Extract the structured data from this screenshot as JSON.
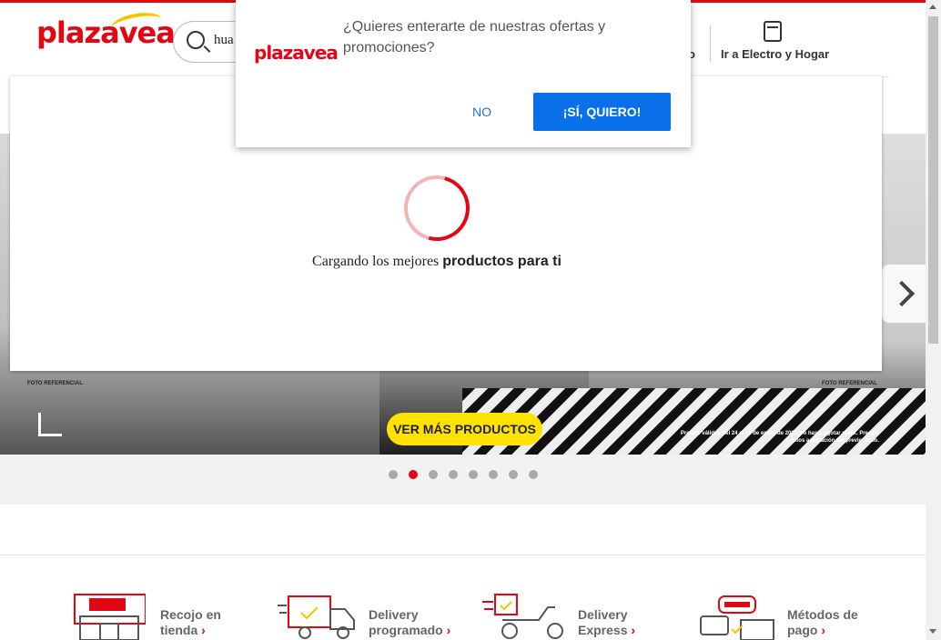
{
  "header": {
    "logo_text": "plazavea",
    "search_value": "hua",
    "link_partial": "o",
    "electro_link": "Ir a Electro y Hogar"
  },
  "banner": {
    "cta_label": "VER MÁS PRODUCTOS",
    "foto_referencial_1": "FOTO REFERENCIAL",
    "foto_referencial_2": "FOTO REFERENCIAL",
    "legal": "Precios válidos del 24 al 29 de enero de 2020 y/o hasta agotar stock. Precios sujetos a variación sin previo aviso.",
    "slide_count": 8,
    "active_slide": 2
  },
  "loading": {
    "text_normal": "Cargando los mejores ",
    "text_bold": "productos para ti"
  },
  "push_popup": {
    "logo_text": "plazavea",
    "message": "¿Quieres enterarte de nuestras ofertas y promociones?",
    "no_label": "NO",
    "yes_label": "¡SÍ, QUIERO!"
  },
  "services": [
    {
      "line1": "Recojo en",
      "line2": "tienda",
      "icon": "store-pickup-icon"
    },
    {
      "line1": "Delivery",
      "line2": "programado",
      "icon": "delivery-truck-icon"
    },
    {
      "line1": "Delivery",
      "line2": "Express",
      "icon": "delivery-scooter-icon"
    },
    {
      "line1": "Métodos de",
      "line2": "pago",
      "icon": "payment-methods-icon"
    }
  ],
  "colors": {
    "brand_red": "#e30613",
    "brand_yellow": "#ffe200",
    "accept_blue": "#0a70ea"
  }
}
